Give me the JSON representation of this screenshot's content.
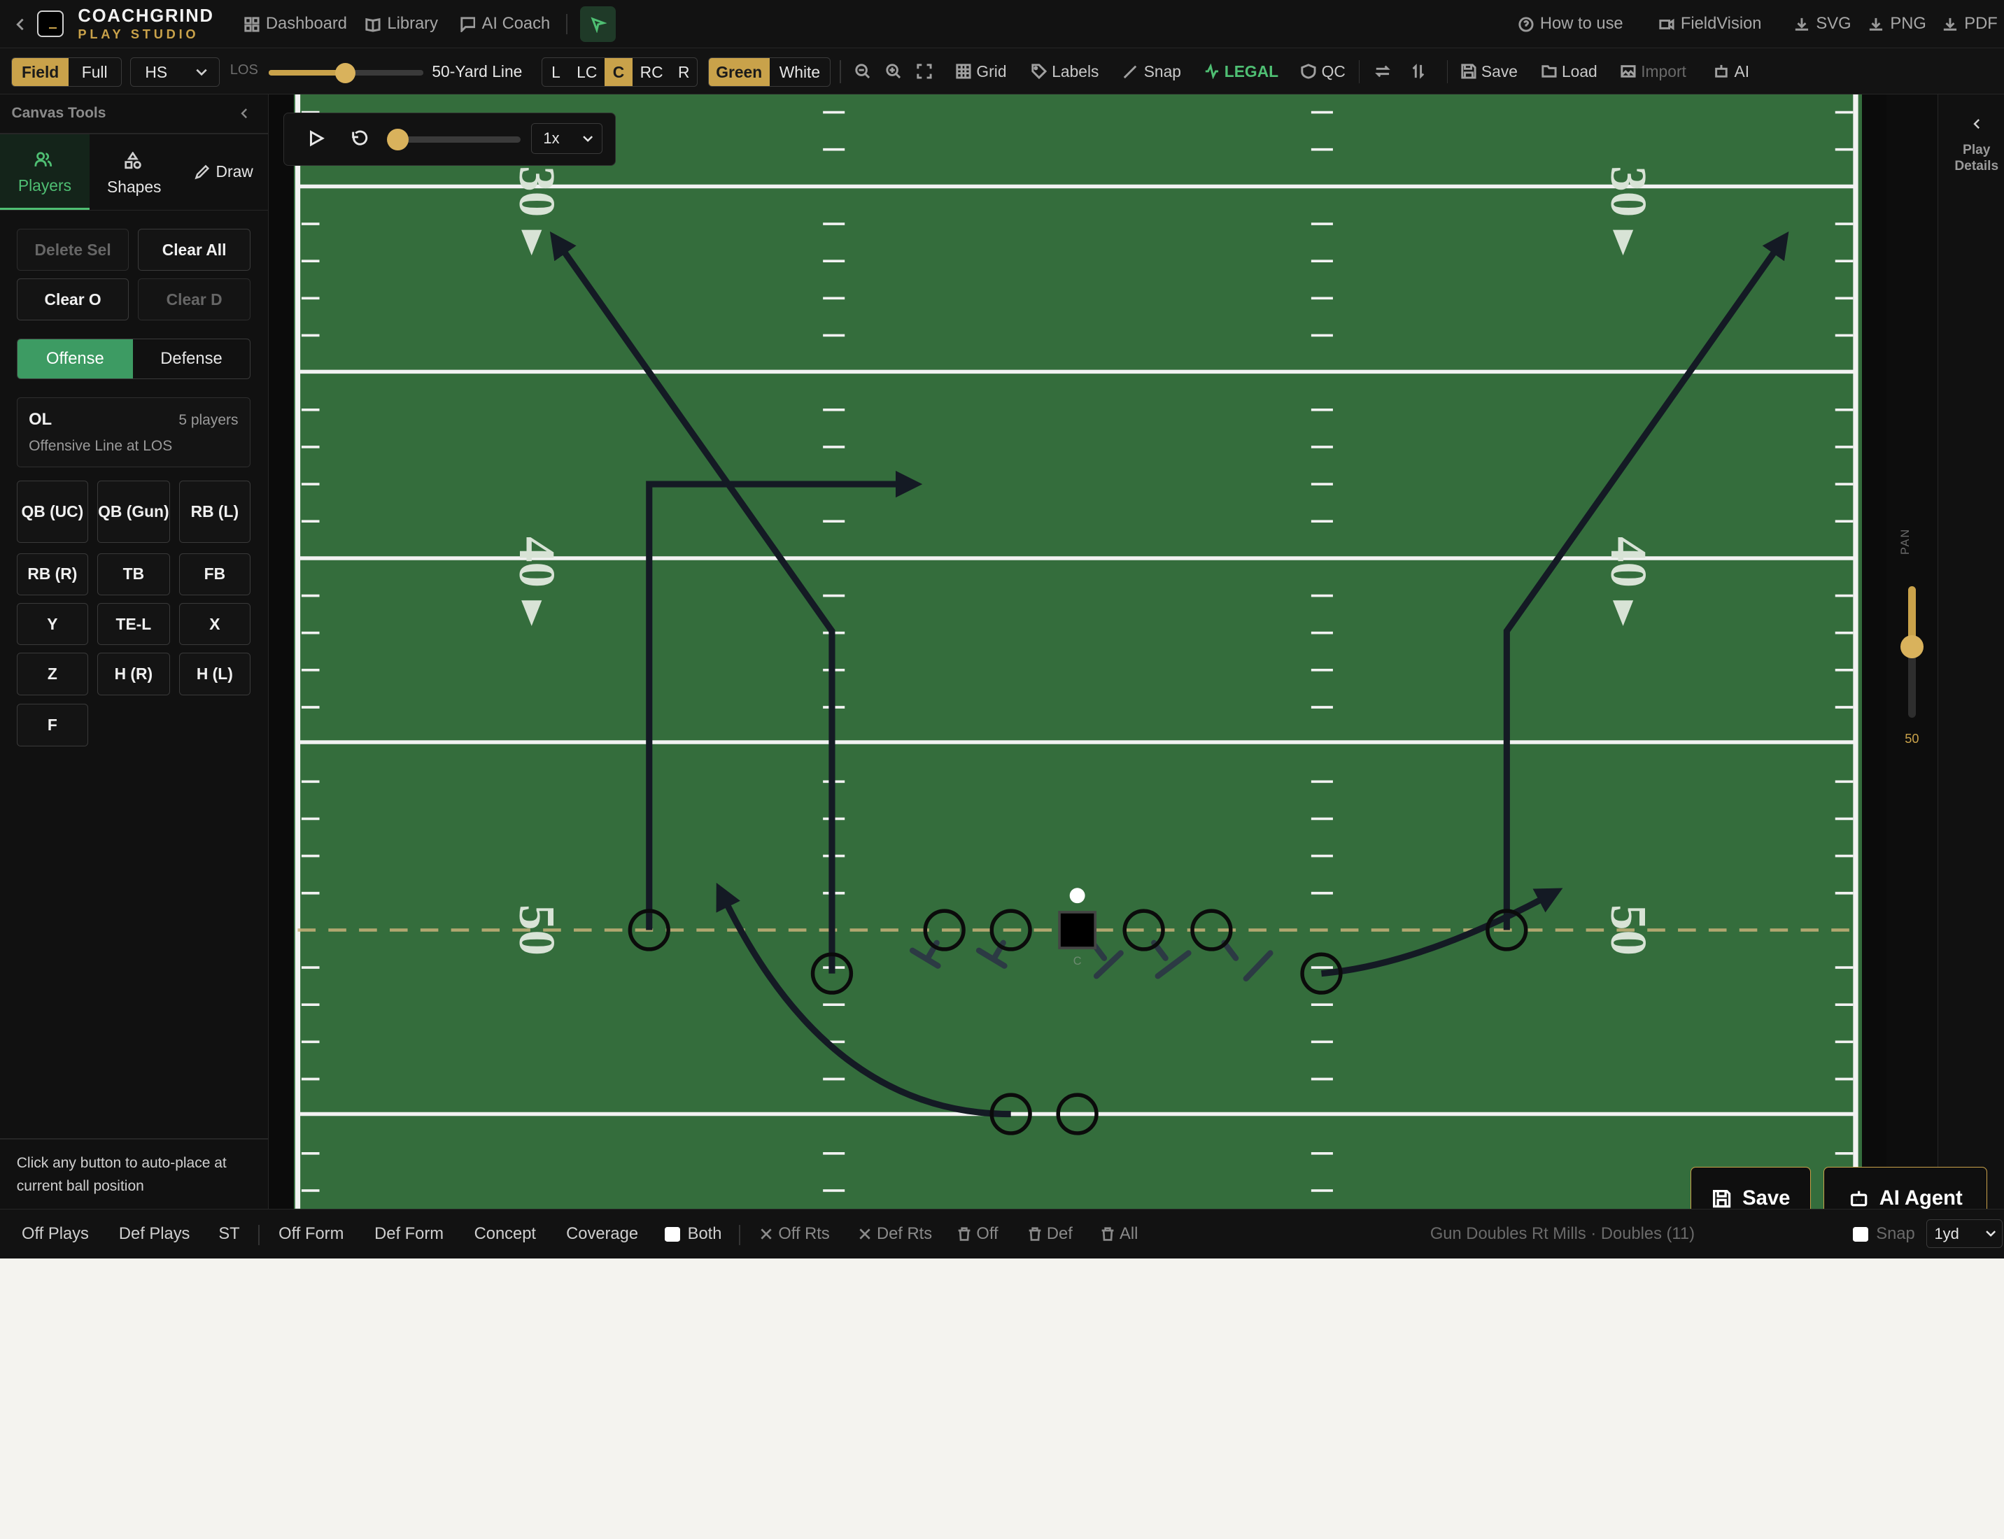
{
  "brand": {
    "name": "COACHGRIND",
    "sub": "PLAY STUDIO"
  },
  "nav": {
    "dashboard": "Dashboard",
    "library": "Library",
    "ai_coach": "AI Coach",
    "how_to_use": "How to use",
    "fieldvision": "FieldVision",
    "svg": "SVG",
    "png": "PNG",
    "pdf": "PDF"
  },
  "toolbar": {
    "view_modes": [
      "Field",
      "Full"
    ],
    "view_active": "Field",
    "level": "HS",
    "los_label": "LOS",
    "los_value_text": "50-Yard Line",
    "hash_options": [
      "L",
      "LC",
      "C",
      "RC",
      "R"
    ],
    "hash_active": "C",
    "field_colors": [
      "Green",
      "White"
    ],
    "color_active": "Green",
    "grid": "Grid",
    "labels": "Labels",
    "snap": "Snap",
    "legal": "LEGAL",
    "qc": "QC",
    "save": "Save",
    "load": "Load",
    "import": "Import",
    "ai": "AI",
    "colors": {
      "accent": "#c9a24a",
      "legal": "#4fbf73"
    }
  },
  "sidebar": {
    "title": "Canvas Tools",
    "tabs": [
      "Players",
      "Shapes",
      "Draw"
    ],
    "tab_active": "Players",
    "actions": {
      "delete_sel": "Delete Sel",
      "clear_all": "Clear All",
      "clear_o": "Clear O",
      "clear_d": "Clear D"
    },
    "sides": [
      "Offense",
      "Defense"
    ],
    "side_active": "Offense",
    "group": {
      "name": "OL",
      "count": "5 players",
      "desc": "Offensive Line at LOS"
    },
    "positions": [
      "QB (UC)",
      "QB (Gun)",
      "RB (L)",
      "RB (R)",
      "TB",
      "FB",
      "Y",
      "TE-L",
      "X",
      "Z",
      "H (R)",
      "H (L)",
      "F"
    ],
    "hint": "Click any button to auto-place at current ball position"
  },
  "playback": {
    "speed": "1x",
    "progress": 0
  },
  "field": {
    "yard_numbers": [
      "30",
      "40",
      "50"
    ],
    "center_label": "C",
    "colors": {
      "turf": "#346d3c",
      "route": "#141a24",
      "los": "#c9b27a"
    }
  },
  "pan": {
    "label": "PAN",
    "value": "50"
  },
  "details": {
    "label_line1": "Play",
    "label_line2": "Details"
  },
  "bottom": {
    "items": [
      "Off Plays",
      "Def Plays",
      "ST",
      "Off Form",
      "Def Form",
      "Concept",
      "Coverage"
    ],
    "both": "Both",
    "off_rts": "Off Rts",
    "def_rts": "Def Rts",
    "off": "Off",
    "def": "Def",
    "all": "All",
    "play_name": "Gun Doubles Rt Mills · Doubles (11)",
    "snap": "Snap",
    "step": "1yd"
  },
  "floating": {
    "save": "Save",
    "ai_agent": "AI Agent"
  }
}
